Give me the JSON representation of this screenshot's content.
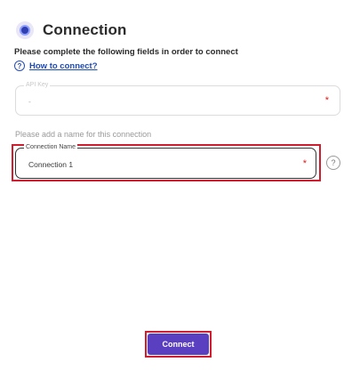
{
  "header": {
    "title": "Connection",
    "logo_icon": "connector-logo-icon"
  },
  "instructions": "Please complete the following fields in order to connect",
  "help": {
    "icon": "question-circle-icon",
    "link_label": "How to connect?"
  },
  "fields": {
    "api_key": {
      "label": "API Key",
      "value": "-",
      "required_mark": "*"
    },
    "name_hint": "Please add a name for this connection",
    "connection_name": {
      "label": "Connection Name",
      "value": "Connection 1",
      "required_mark": "*"
    }
  },
  "side_help_icon": "?",
  "help_glyph": "?",
  "connect_button": {
    "label": "Connect"
  },
  "colors": {
    "accent": "#5a3fc0",
    "highlight": "#d11e2e",
    "link": "#1f4bb5",
    "required": "#e01d1d"
  }
}
